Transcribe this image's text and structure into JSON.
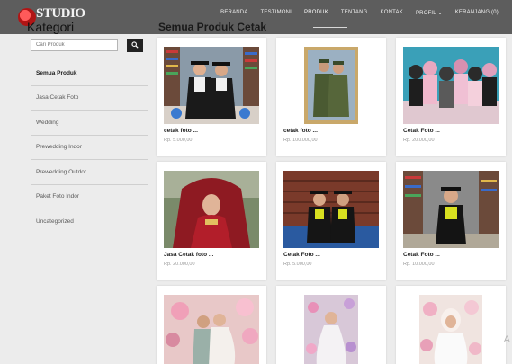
{
  "header": {
    "logo_text": "STUDIO",
    "section_title": "Kategori",
    "page_heading": "Semua Produk Cetak",
    "nav": [
      {
        "label": "BERANDA",
        "active": false
      },
      {
        "label": "TESTIMONI",
        "active": false
      },
      {
        "label": "PRODUK",
        "active": true
      },
      {
        "label": "TENTANG",
        "active": false
      },
      {
        "label": "KONTAK",
        "active": false
      },
      {
        "label": "PROFIL ⌄",
        "active": false
      },
      {
        "label": "KERANJANG (0)",
        "active": false
      }
    ]
  },
  "sidebar": {
    "search_placeholder": "Cari Produk",
    "search_icon": "search-icon",
    "categories": [
      {
        "label": "Semua Produk",
        "active": true
      },
      {
        "label": "Jasa Cetak Foto",
        "active": false
      },
      {
        "label": "Wedding",
        "active": false
      },
      {
        "label": "Prewedding Indor",
        "active": false
      },
      {
        "label": "Prewedding Outdor",
        "active": false
      },
      {
        "label": "Paket Foto Indor",
        "active": false
      },
      {
        "label": "Uncategorized",
        "active": false
      }
    ]
  },
  "products": [
    {
      "name": "cetak foto ...",
      "price": "Rp. 5.000,00",
      "photo": "graduation-couple-photo"
    },
    {
      "name": "cetak foto ...",
      "price": "Rp. 100.000,00",
      "photo": "military-couple-photo"
    },
    {
      "name": "Cetak Foto ...",
      "price": "Rp. 20.000,00",
      "photo": "group-hijab-photo"
    },
    {
      "name": "Jasa Cetak foto ...",
      "price": "Rp. 20.000,00",
      "photo": "bride-red-veil-photo"
    },
    {
      "name": "Cetak Foto ...",
      "price": "Rp. 5.000,00",
      "photo": "graduation-couple-brick-photo"
    },
    {
      "name": "Cetak Foto ...",
      "price": "Rp. 10.000,00",
      "photo": "graduation-single-photo"
    },
    {
      "name": "",
      "price": "",
      "photo": "wedding-couple-floral-photo"
    },
    {
      "name": "",
      "price": "",
      "photo": "bride-white-dress-photo"
    },
    {
      "name": "",
      "price": "",
      "photo": "bride-hijab-pink-photo"
    }
  ],
  "colors": {
    "topbar": "#5d5d5d",
    "page_bg": "#ececec",
    "card_bg": "#ffffff",
    "search_button": "#222222"
  },
  "watermark": "A"
}
